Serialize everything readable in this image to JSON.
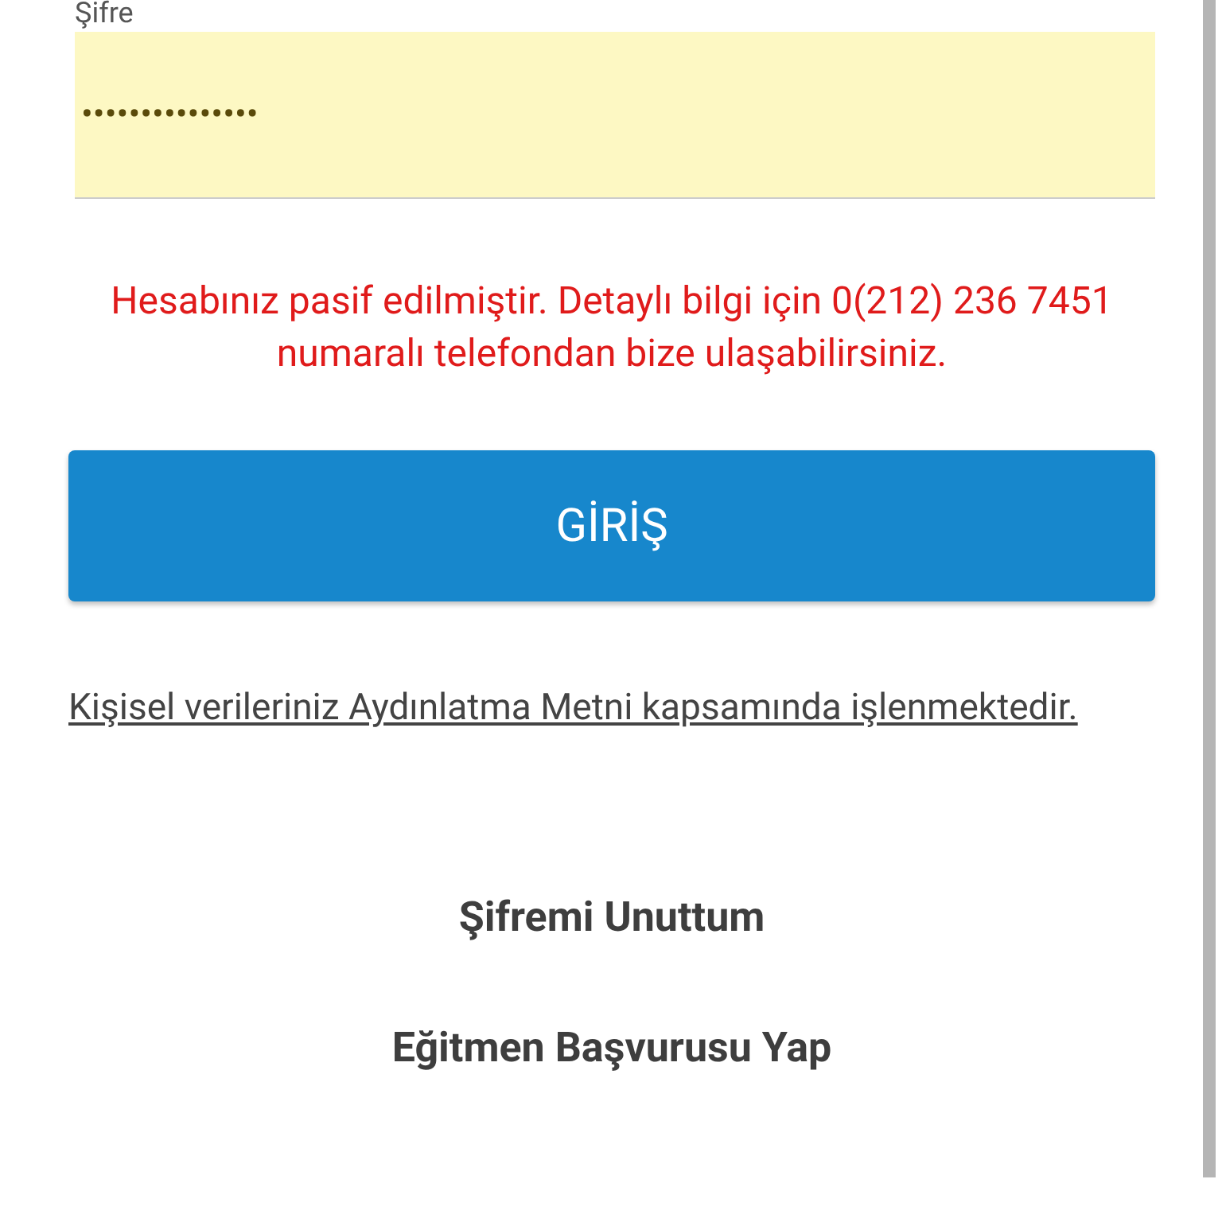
{
  "password_field": {
    "label": "Şifre",
    "value": "•••••••••••••••"
  },
  "error_message": "Hesabınız pasif edilmiştir. Detaylı bilgi için 0(212) 236 7451 numaralı telefondan bize ulaşabilirsiniz.",
  "login_button": "GİRİŞ",
  "privacy_link": "Kişisel verileriniz Aydınlatma Metni kapsamında işlenmektedir.",
  "links": [
    "Şifremi Unuttum",
    "Eğitmen Başvurusu Yap"
  ]
}
